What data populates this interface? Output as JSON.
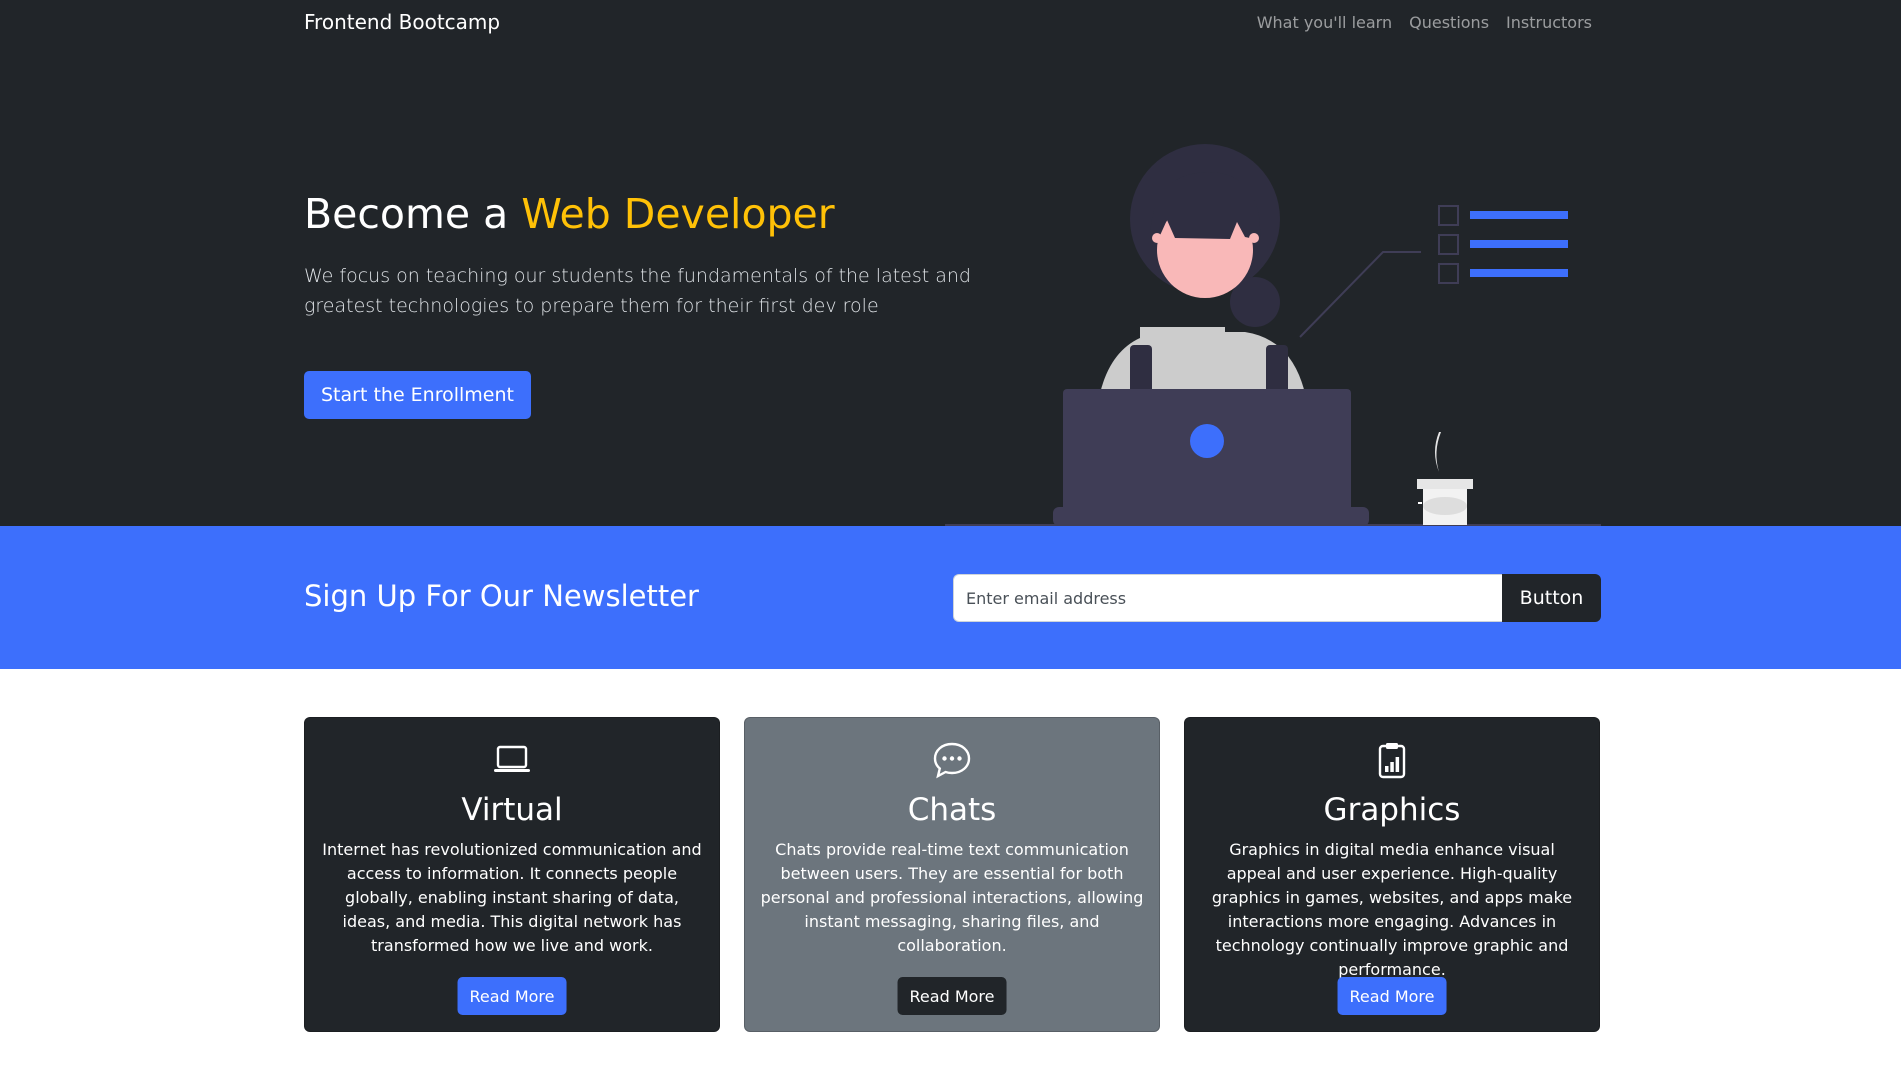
{
  "navbar": {
    "brand": "Frontend Bootcamp",
    "links": [
      {
        "label": "What you'll learn"
      },
      {
        "label": "Questions"
      },
      {
        "label": "Instructors"
      }
    ]
  },
  "hero": {
    "title_prefix": "Become a ",
    "title_accent": "Web Developer",
    "lead": "We focus on teaching our students the fundamentals of the latest and greatest technologies to prepare them for their first dev role",
    "cta_label": "Start the Enrollment"
  },
  "newsletter": {
    "title": "Sign Up For Our Newsletter",
    "email_placeholder": "Enter email address",
    "email_value": "",
    "button_label": "Button"
  },
  "cards": [
    {
      "icon": "laptop-icon",
      "title": "Virtual",
      "text": "Internet has revolutionized communication and access to information. It connects people globally, enabling instant sharing of data, ideas, and media. This digital network has transformed how we live and work.",
      "button_label": "Read More"
    },
    {
      "icon": "chat-dots-icon",
      "title": "Chats",
      "text": "Chats provide real-time text communication between users. They are essential for both personal and professional interactions, allowing instant messaging, sharing files, and collaboration.",
      "button_label": "Read More"
    },
    {
      "icon": "clipboard-chart-icon",
      "title": "Graphics",
      "text": "Graphics in digital media enhance visual appeal and user experience. High-quality graphics in games, websites, and apps make interactions more engaging. Advances in technology continually improve graphic and performance.",
      "button_label": "Read More"
    }
  ],
  "colors": {
    "dark": "#212529",
    "primary": "#3d6ffc",
    "accent": "#ffc107",
    "grey": "#6c757d"
  }
}
